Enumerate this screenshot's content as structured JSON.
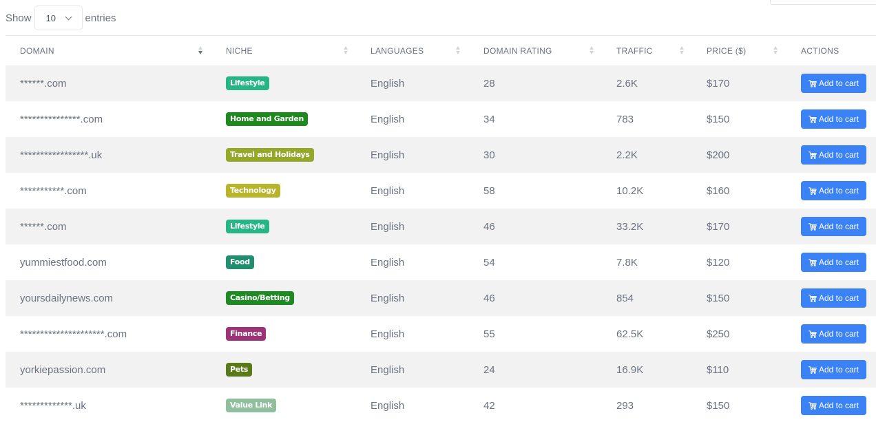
{
  "length_control": {
    "prefix": "Show",
    "selected": "10",
    "suffix": "entries"
  },
  "columns": [
    "DOMAIN",
    "NICHE",
    "LANGUAGES",
    "DOMAIN RATING",
    "TRAFFIC",
    "PRICE ($)",
    "ACTIONS"
  ],
  "sort": {
    "column": "DOMAIN",
    "direction": "descending"
  },
  "action_label": "Add to cart",
  "icons": {
    "cart": "shopping-cart-icon",
    "dropdown": "chevron-down-icon"
  },
  "colors": {
    "button": "#3b82f6",
    "stripe": "#f2f2f2",
    "niche": {
      "Lifestyle": "#27b586",
      "Home and Garden": "#1e8a1e",
      "Travel and Holidays": "#95a82a",
      "Technology": "#b8b52a",
      "Food": "#1f8f6f",
      "Casino/Betting": "#1f8a24",
      "Finance": "#9c3377",
      "Pets": "#5a7a1a",
      "Value Link": "#8fbf9c"
    }
  },
  "rows": [
    {
      "domain": "******.com",
      "niche": "Lifestyle",
      "language": "English",
      "rating": "28",
      "traffic": "2.6K",
      "price": "$170"
    },
    {
      "domain": "***************.com",
      "niche": "Home and Garden",
      "language": "English",
      "rating": "34",
      "traffic": "783",
      "price": "$150"
    },
    {
      "domain": "*****************.uk",
      "niche": "Travel and Holidays",
      "language": "English",
      "rating": "30",
      "traffic": "2.2K",
      "price": "$200"
    },
    {
      "domain": "***********.com",
      "niche": "Technology",
      "language": "English",
      "rating": "58",
      "traffic": "10.2K",
      "price": "$160"
    },
    {
      "domain": "******.com",
      "niche": "Lifestyle",
      "language": "English",
      "rating": "46",
      "traffic": "33.2K",
      "price": "$170"
    },
    {
      "domain": "yummiestfood.com",
      "niche": "Food",
      "language": "English",
      "rating": "54",
      "traffic": "7.8K",
      "price": "$120"
    },
    {
      "domain": "yoursdailynews.com",
      "niche": "Casino/Betting",
      "language": "English",
      "rating": "46",
      "traffic": "854",
      "price": "$150"
    },
    {
      "domain": "*********************.com",
      "niche": "Finance",
      "language": "English",
      "rating": "55",
      "traffic": "62.5K",
      "price": "$250"
    },
    {
      "domain": "yorkiepassion.com",
      "niche": "Pets",
      "language": "English",
      "rating": "24",
      "traffic": "16.9K",
      "price": "$110"
    },
    {
      "domain": "*************.uk",
      "niche": "Value Link",
      "language": "English",
      "rating": "42",
      "traffic": "293",
      "price": "$150"
    }
  ]
}
